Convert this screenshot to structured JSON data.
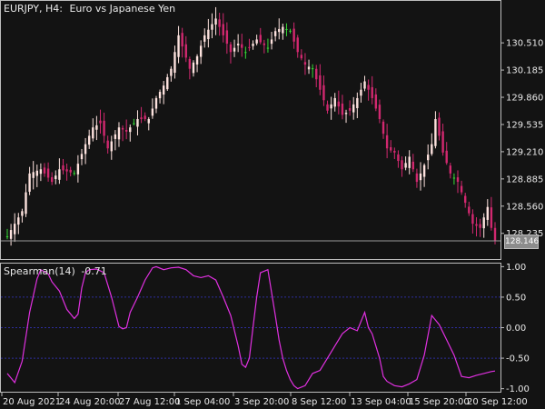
{
  "window": {
    "symbol": "EURJPY, H4:",
    "description": "Euro vs Japanese Yen",
    "current_price": "128.146"
  },
  "indicator": {
    "name": "Spearman(14)",
    "value": "-0.71",
    "levels": [
      0.5,
      0.0,
      -0.5
    ]
  },
  "colors": {
    "background": "#131313",
    "frame": "#bdbdbd",
    "text": "#e8e8e8",
    "bull_candle": "#fde2de",
    "bear_candle": "#d1286f",
    "doji_candle": "#36d936",
    "indicator_line": "#e030e0",
    "level_line": "#2d2d9c",
    "price_line": "#9a9a9a"
  },
  "chart_data": [
    {
      "type": "candlestick",
      "title": "EURJPY, H4: Euro vs Japanese Yen",
      "ylim": [
        127.95,
        131.0
      ],
      "yticks": [
        "130.510",
        "130.185",
        "129.860",
        "129.535",
        "129.210",
        "128.885",
        "128.560",
        "128.235"
      ],
      "current_price": 128.146,
      "close_path": [
        [
          0,
          128.2
        ],
        [
          4,
          128.5
        ],
        [
          6,
          128.95
        ],
        [
          9,
          129.0
        ],
        [
          12,
          128.85
        ],
        [
          14,
          129.0
        ],
        [
          18,
          128.95
        ],
        [
          21,
          129.3
        ],
        [
          23,
          129.5
        ],
        [
          25,
          129.55
        ],
        [
          27,
          129.25
        ],
        [
          30,
          129.5
        ],
        [
          32,
          129.45
        ],
        [
          35,
          129.6
        ],
        [
          38,
          129.6
        ],
        [
          40,
          129.85
        ],
        [
          42,
          130.0
        ],
        [
          44,
          130.2
        ],
        [
          46,
          130.6
        ],
        [
          49,
          130.2
        ],
        [
          51,
          130.35
        ],
        [
          53,
          130.6
        ],
        [
          56,
          130.8
        ],
        [
          58,
          130.6
        ],
        [
          60,
          130.4
        ],
        [
          62,
          130.5
        ],
        [
          64,
          130.4
        ],
        [
          67,
          130.55
        ],
        [
          70,
          130.45
        ],
        [
          72,
          130.65
        ],
        [
          74,
          130.7
        ],
        [
          76,
          130.65
        ],
        [
          78,
          130.4
        ],
        [
          80,
          130.25
        ],
        [
          82,
          130.2
        ],
        [
          84,
          129.95
        ],
        [
          86,
          129.7
        ],
        [
          88,
          129.85
        ],
        [
          90,
          129.65
        ],
        [
          92,
          129.7
        ],
        [
          94,
          129.85
        ],
        [
          96,
          130.05
        ],
        [
          98,
          129.85
        ],
        [
          100,
          129.6
        ],
        [
          102,
          129.25
        ],
        [
          104,
          129.2
        ],
        [
          106,
          129.0
        ],
        [
          108,
          129.15
        ],
        [
          110,
          128.85
        ],
        [
          112,
          129.05
        ],
        [
          114,
          129.3
        ],
        [
          115,
          129.6
        ],
        [
          117,
          129.2
        ],
        [
          119,
          128.95
        ],
        [
          121,
          128.85
        ],
        [
          123,
          128.6
        ],
        [
          125,
          128.35
        ],
        [
          127,
          128.3
        ],
        [
          129,
          128.55
        ],
        [
          130,
          128.3
        ],
        [
          131,
          128.15
        ]
      ]
    },
    {
      "type": "line",
      "title": "Spearman(14) -0.71",
      "ylim": [
        -1.05,
        1.05
      ],
      "yticks": [
        "1.00",
        "0.50",
        "0.00",
        "-0.50",
        "-1.00"
      ],
      "levels": [
        0.5,
        0.0,
        -0.5
      ],
      "xticks": [
        "20 Aug 2021",
        "24 Aug 20:00",
        "27 Aug 12:00",
        "1 Sep 04:00",
        "3 Sep 20:00",
        "8 Sep 12:00",
        "13 Sep 04:00",
        "15 Sep 20:00",
        "20 Sep 12:00"
      ],
      "series": [
        {
          "x": [
            0,
            2,
            4,
            6,
            8,
            9,
            11,
            12,
            14,
            16,
            18,
            19,
            20,
            21,
            22,
            24,
            26,
            28,
            30,
            31,
            32,
            33,
            35,
            37,
            39,
            40,
            42,
            44,
            46,
            48,
            50,
            52,
            54,
            56,
            58,
            60,
            62,
            63,
            64,
            65,
            66,
            67,
            68,
            70,
            72,
            73,
            74,
            75,
            76,
            77,
            78,
            80,
            82,
            84,
            86,
            88,
            90,
            92,
            94,
            96,
            97,
            98,
            100,
            101,
            102,
            104,
            106,
            108,
            110,
            112,
            114,
            116,
            118,
            120,
            122,
            124,
            126,
            128,
            130,
            131
          ],
          "y": [
            -0.75,
            -0.9,
            -0.55,
            0.25,
            0.8,
            0.95,
            0.88,
            0.75,
            0.6,
            0.3,
            0.15,
            0.22,
            0.65,
            0.9,
            0.95,
            0.96,
            0.9,
            0.5,
            0.02,
            -0.02,
            0.0,
            0.25,
            0.5,
            0.78,
            0.98,
            1.0,
            0.95,
            0.98,
            0.99,
            0.95,
            0.85,
            0.82,
            0.85,
            0.78,
            0.5,
            0.2,
            -0.3,
            -0.6,
            -0.65,
            -0.5,
            0.0,
            0.5,
            0.9,
            0.95,
            0.2,
            -0.2,
            -0.5,
            -0.7,
            -0.85,
            -0.95,
            -1.0,
            -0.95,
            -0.75,
            -0.7,
            -0.5,
            -0.3,
            -0.1,
            0.0,
            -0.05,
            0.25,
            0.0,
            -0.1,
            -0.5,
            -0.8,
            -0.88,
            -0.95,
            -0.97,
            -0.92,
            -0.85,
            -0.45,
            0.2,
            0.05,
            -0.2,
            -0.45,
            -0.8,
            -0.82,
            -0.78,
            -0.75,
            -0.72,
            -0.71
          ],
          "color": "#e030e0"
        }
      ]
    }
  ]
}
